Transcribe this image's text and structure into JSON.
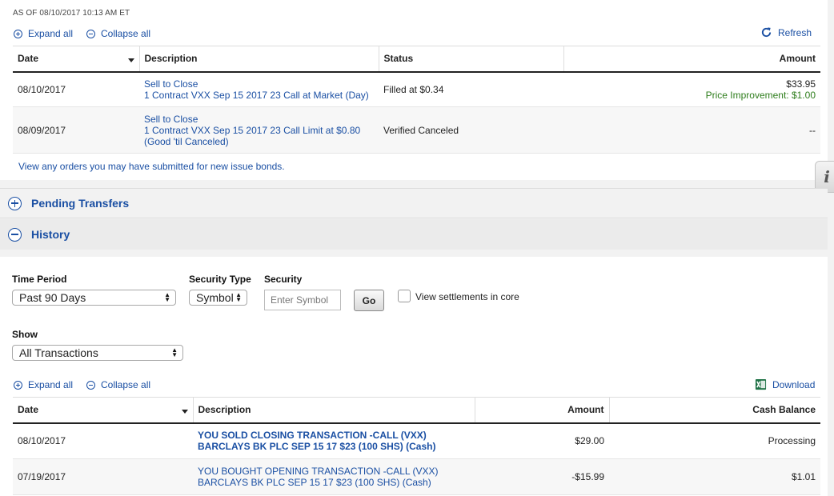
{
  "as_of": "AS OF 08/10/2017 10:13 AM ET",
  "orders": {
    "expand_all": "Expand all",
    "collapse_all": "Collapse all",
    "refresh": "Refresh",
    "columns": {
      "date": "Date",
      "description": "Description",
      "status": "Status",
      "amount": "Amount"
    },
    "rows": [
      {
        "date": "08/10/2017",
        "desc_line1": "Sell to Close",
        "desc_line2": "1 Contract VXX Sep 15 2017 23 Call at Market (Day)",
        "desc_line3": "",
        "status": "Filled at $0.34",
        "amount": "$33.95",
        "amount_note": "Price Improvement: $1.00"
      },
      {
        "date": "08/09/2017",
        "desc_line1": "Sell to Close",
        "desc_line2": "1 Contract VXX Sep 15 2017 23 Call Limit at $0.80",
        "desc_line3": "(Good 'til Canceled)",
        "status": "Verified Canceled",
        "amount": "--",
        "amount_note": ""
      }
    ],
    "new_issue_link": "View any orders you may have submitted for new issue bonds."
  },
  "pending_transfers": {
    "title": "Pending Transfers"
  },
  "history": {
    "title": "History",
    "time_period_label": "Time Period",
    "time_period_value": "Past 90 Days",
    "security_type_label": "Security Type",
    "security_type_value": "Symbol",
    "security_label": "Security",
    "security_placeholder": "Enter Symbol",
    "go_label": "Go",
    "settlements_label": "View settlements in core",
    "show_label": "Show",
    "show_value": "All Transactions",
    "expand_all": "Expand all",
    "collapse_all": "Collapse all",
    "download": "Download",
    "columns": {
      "date": "Date",
      "description": "Description",
      "amount": "Amount",
      "cash_balance": "Cash Balance"
    },
    "rows": [
      {
        "date": "08/10/2017",
        "desc_line1": "YOU SOLD CLOSING TRANSACTION -CALL (VXX)",
        "desc_line2": "BARCLAYS BK PLC SEP 15 17 $23 (100 SHS) (Cash)",
        "amount": "$29.00",
        "cash_balance": "Processing"
      },
      {
        "date": "07/19/2017",
        "desc_line1": "YOU BOUGHT OPENING TRANSACTION -CALL (VXX)",
        "desc_line2": "BARCLAYS BK PLC SEP 15 17 $23 (100 SHS) (Cash)",
        "amount": "-$15.99",
        "cash_balance": "$1.01"
      }
    ]
  },
  "info_tab": "i"
}
